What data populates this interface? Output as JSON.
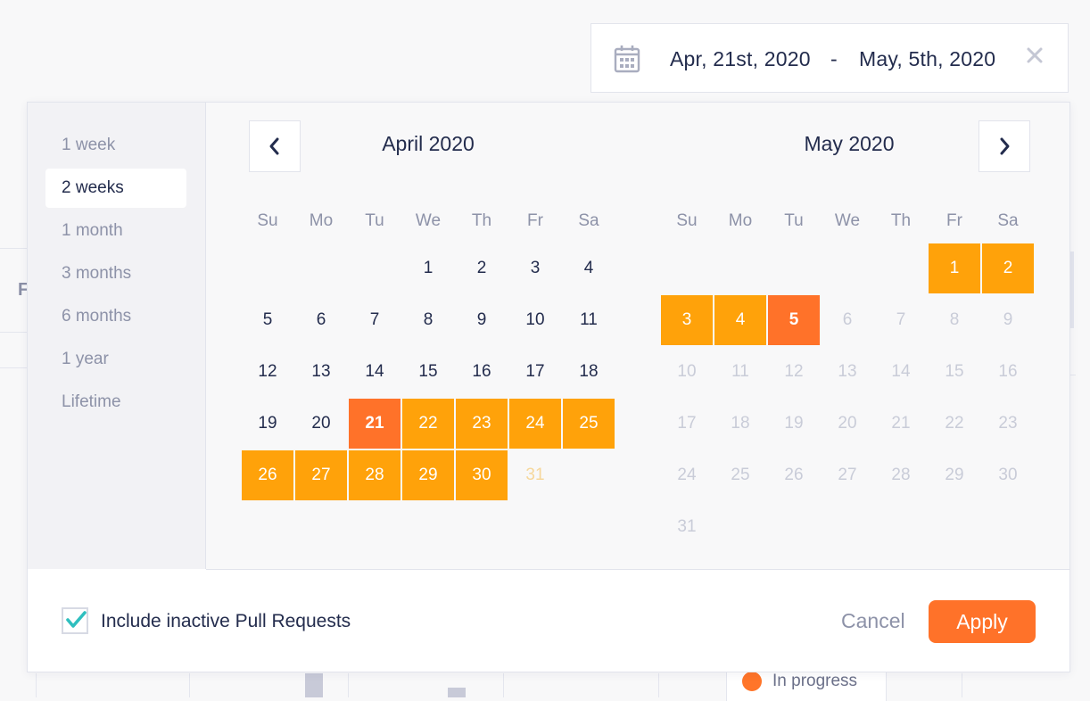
{
  "range": {
    "start": "Apr, 21st, 2020",
    "separator": "-",
    "end": "May, 5th, 2020"
  },
  "presets": [
    "1 week",
    "2 weeks",
    "1 month",
    "3 months",
    "6 months",
    "1 year",
    "Lifetime"
  ],
  "active_preset": "2 weeks",
  "weekdays": [
    "Su",
    "Mo",
    "Tu",
    "We",
    "Th",
    "Fr",
    "Sa"
  ],
  "calendars": [
    {
      "title": "April 2020",
      "days": [
        {
          "label": "1",
          "col": 3,
          "row": 0,
          "state": "normal"
        },
        {
          "label": "2",
          "col": 4,
          "row": 0,
          "state": "normal"
        },
        {
          "label": "3",
          "col": 5,
          "row": 0,
          "state": "normal"
        },
        {
          "label": "4",
          "col": 6,
          "row": 0,
          "state": "normal"
        },
        {
          "label": "5",
          "col": 0,
          "row": 1,
          "state": "normal"
        },
        {
          "label": "6",
          "col": 1,
          "row": 1,
          "state": "normal"
        },
        {
          "label": "7",
          "col": 2,
          "row": 1,
          "state": "normal"
        },
        {
          "label": "8",
          "col": 3,
          "row": 1,
          "state": "normal"
        },
        {
          "label": "9",
          "col": 4,
          "row": 1,
          "state": "normal"
        },
        {
          "label": "10",
          "col": 5,
          "row": 1,
          "state": "normal"
        },
        {
          "label": "11",
          "col": 6,
          "row": 1,
          "state": "normal"
        },
        {
          "label": "12",
          "col": 0,
          "row": 2,
          "state": "normal"
        },
        {
          "label": "13",
          "col": 1,
          "row": 2,
          "state": "normal"
        },
        {
          "label": "14",
          "col": 2,
          "row": 2,
          "state": "normal"
        },
        {
          "label": "15",
          "col": 3,
          "row": 2,
          "state": "normal"
        },
        {
          "label": "16",
          "col": 4,
          "row": 2,
          "state": "normal"
        },
        {
          "label": "17",
          "col": 5,
          "row": 2,
          "state": "normal"
        },
        {
          "label": "18",
          "col": 6,
          "row": 2,
          "state": "normal"
        },
        {
          "label": "19",
          "col": 0,
          "row": 3,
          "state": "normal"
        },
        {
          "label": "20",
          "col": 1,
          "row": 3,
          "state": "normal"
        },
        {
          "label": "21",
          "col": 2,
          "row": 3,
          "state": "edge"
        },
        {
          "label": "22",
          "col": 3,
          "row": 3,
          "state": "sel"
        },
        {
          "label": "23",
          "col": 4,
          "row": 3,
          "state": "sel"
        },
        {
          "label": "24",
          "col": 5,
          "row": 3,
          "state": "sel"
        },
        {
          "label": "25",
          "col": 6,
          "row": 3,
          "state": "sel"
        },
        {
          "label": "26",
          "col": 0,
          "row": 4,
          "state": "sel"
        },
        {
          "label": "27",
          "col": 1,
          "row": 4,
          "state": "sel"
        },
        {
          "label": "28",
          "col": 2,
          "row": 4,
          "state": "sel"
        },
        {
          "label": "29",
          "col": 3,
          "row": 4,
          "state": "sel"
        },
        {
          "label": "30",
          "col": 4,
          "row": 4,
          "state": "sel"
        },
        {
          "label": "31",
          "col": 5,
          "row": 4,
          "state": "ghost"
        }
      ]
    },
    {
      "title": "May 2020",
      "days": [
        {
          "label": "1",
          "col": 5,
          "row": 0,
          "state": "sel"
        },
        {
          "label": "2",
          "col": 6,
          "row": 0,
          "state": "sel"
        },
        {
          "label": "3",
          "col": 0,
          "row": 1,
          "state": "sel"
        },
        {
          "label": "4",
          "col": 1,
          "row": 1,
          "state": "sel"
        },
        {
          "label": "5",
          "col": 2,
          "row": 1,
          "state": "edge"
        },
        {
          "label": "6",
          "col": 3,
          "row": 1,
          "state": "dim"
        },
        {
          "label": "7",
          "col": 4,
          "row": 1,
          "state": "dim"
        },
        {
          "label": "8",
          "col": 5,
          "row": 1,
          "state": "dim"
        },
        {
          "label": "9",
          "col": 6,
          "row": 1,
          "state": "dim"
        },
        {
          "label": "10",
          "col": 0,
          "row": 2,
          "state": "dim"
        },
        {
          "label": "11",
          "col": 1,
          "row": 2,
          "state": "dim"
        },
        {
          "label": "12",
          "col": 2,
          "row": 2,
          "state": "dim"
        },
        {
          "label": "13",
          "col": 3,
          "row": 2,
          "state": "dim"
        },
        {
          "label": "14",
          "col": 4,
          "row": 2,
          "state": "dim"
        },
        {
          "label": "15",
          "col": 5,
          "row": 2,
          "state": "dim"
        },
        {
          "label": "16",
          "col": 6,
          "row": 2,
          "state": "dim"
        },
        {
          "label": "17",
          "col": 0,
          "row": 3,
          "state": "dim"
        },
        {
          "label": "18",
          "col": 1,
          "row": 3,
          "state": "dim"
        },
        {
          "label": "19",
          "col": 2,
          "row": 3,
          "state": "dim"
        },
        {
          "label": "20",
          "col": 3,
          "row": 3,
          "state": "dim"
        },
        {
          "label": "21",
          "col": 4,
          "row": 3,
          "state": "dim"
        },
        {
          "label": "22",
          "col": 5,
          "row": 3,
          "state": "dim"
        },
        {
          "label": "23",
          "col": 6,
          "row": 3,
          "state": "dim"
        },
        {
          "label": "24",
          "col": 0,
          "row": 4,
          "state": "dim"
        },
        {
          "label": "25",
          "col": 1,
          "row": 4,
          "state": "dim"
        },
        {
          "label": "26",
          "col": 2,
          "row": 4,
          "state": "dim"
        },
        {
          "label": "27",
          "col": 3,
          "row": 4,
          "state": "dim"
        },
        {
          "label": "28",
          "col": 4,
          "row": 4,
          "state": "dim"
        },
        {
          "label": "29",
          "col": 5,
          "row": 4,
          "state": "dim"
        },
        {
          "label": "30",
          "col": 6,
          "row": 4,
          "state": "dim"
        },
        {
          "label": "31",
          "col": 0,
          "row": 5,
          "state": "dim"
        }
      ]
    }
  ],
  "footer": {
    "include_inactive_label": "Include inactive Pull Requests",
    "include_inactive_checked": true,
    "cancel_label": "Cancel",
    "apply_label": "Apply"
  },
  "background": {
    "legend_label": "In progress",
    "fragment_letter": "F"
  },
  "colors": {
    "accent": "#ff7229",
    "range_fill": "#ffa20a",
    "check": "#2fbfbf",
    "text": "#232c4d",
    "muted": "#8d92a8"
  },
  "icons": {
    "date_icon": "calendar-icon",
    "clear_icon": "close-icon",
    "prev_icon": "chevron-left-icon",
    "next_icon": "chevron-right-icon",
    "check_icon": "checkmark-icon"
  }
}
